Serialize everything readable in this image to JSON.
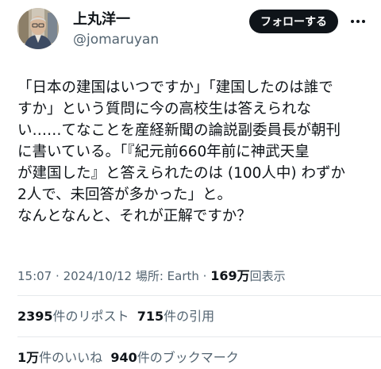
{
  "author": {
    "name": "上丸洋一",
    "handle": "@jomaruyan",
    "follow_label": "フォローする",
    "avatar_icon": "portrait-photo",
    "more_icon": "ellipsis-icon"
  },
  "tweet": {
    "lines": [
      "「日本の建国はいつですか」「建国したのは誰で",
      "すか」という質問に今の高校生は答えられな",
      "い……てなことを産経新聞の論説副委員長が朝刊",
      "に書いている。「『紀元前660年前に神武天皇",
      "が建国した』と答えられたのは (100人中) わずか",
      "2人で、未回答が多かった」と。",
      "なんとなんと、それが正解ですか？"
    ]
  },
  "meta": {
    "time": "15:07",
    "date": "2024/10/12",
    "location": "場所: Earth",
    "views_count": "169万",
    "views_label": "回表示",
    "separator": "·"
  },
  "stats": {
    "reposts_count": "2395",
    "reposts_label": "件のリポスト",
    "quotes_count": "715",
    "quotes_label": "件の引用",
    "likes_count": "1万",
    "likes_label": "件のいいね",
    "bookmarks_count": "940",
    "bookmarks_label": "件のブックマーク"
  },
  "colors": {
    "text": "#0f1419",
    "secondary": "#536471",
    "divider": "#e6e9ec",
    "follow_bg": "#0f1419"
  }
}
